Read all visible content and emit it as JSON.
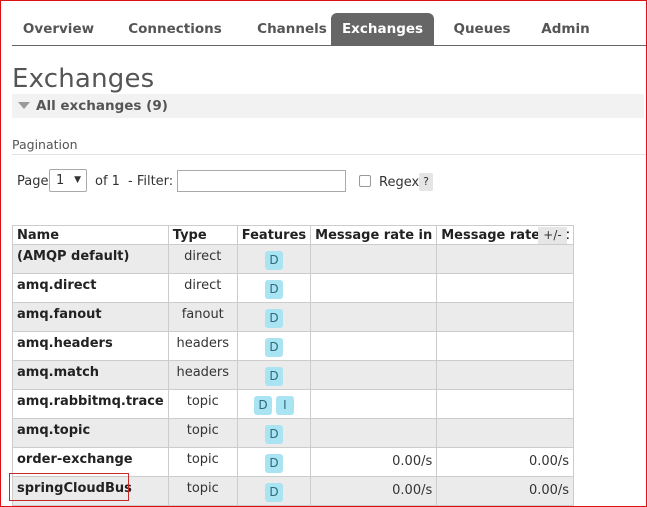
{
  "nav": {
    "tabs": [
      {
        "label": "Overview",
        "active": false
      },
      {
        "label": "Connections",
        "active": false
      },
      {
        "label": "Channels",
        "active": false
      },
      {
        "label": "Exchanges",
        "active": true
      },
      {
        "label": "Queues",
        "active": false
      },
      {
        "label": "Admin",
        "active": false
      }
    ]
  },
  "page": {
    "title": "Exchanges",
    "section_title": "All exchanges (9)"
  },
  "pagination": {
    "label": "Pagination",
    "page_label": "Page",
    "page_value": "1",
    "of_label": "of 1",
    "filter_label": "- Filter:",
    "filter_value": "",
    "regex_label": "Regex",
    "regex_checked": false,
    "help_label": "?"
  },
  "table": {
    "columns": [
      "Name",
      "Type",
      "Features",
      "Message rate in",
      "Message rate out"
    ],
    "column_toggle": "+/-",
    "rows": [
      {
        "name": "(AMQP default)",
        "type": "direct",
        "features": [
          "D"
        ],
        "rate_in": "",
        "rate_out": ""
      },
      {
        "name": "amq.direct",
        "type": "direct",
        "features": [
          "D"
        ],
        "rate_in": "",
        "rate_out": ""
      },
      {
        "name": "amq.fanout",
        "type": "fanout",
        "features": [
          "D"
        ],
        "rate_in": "",
        "rate_out": ""
      },
      {
        "name": "amq.headers",
        "type": "headers",
        "features": [
          "D"
        ],
        "rate_in": "",
        "rate_out": ""
      },
      {
        "name": "amq.match",
        "type": "headers",
        "features": [
          "D"
        ],
        "rate_in": "",
        "rate_out": ""
      },
      {
        "name": "amq.rabbitmq.trace",
        "type": "topic",
        "features": [
          "D",
          "I"
        ],
        "rate_in": "",
        "rate_out": ""
      },
      {
        "name": "amq.topic",
        "type": "topic",
        "features": [
          "D"
        ],
        "rate_in": "",
        "rate_out": ""
      },
      {
        "name": "order-exchange",
        "type": "topic",
        "features": [
          "D"
        ],
        "rate_in": "0.00/s",
        "rate_out": "0.00/s"
      },
      {
        "name": "springCloudBus",
        "type": "topic",
        "features": [
          "D"
        ],
        "rate_in": "0.00/s",
        "rate_out": "0.00/s"
      }
    ]
  },
  "colors": {
    "active_tab": "#666666",
    "feature_badge": "#aae4f2",
    "highlight_border": "#c62828",
    "frame_border": "#dd1111"
  }
}
